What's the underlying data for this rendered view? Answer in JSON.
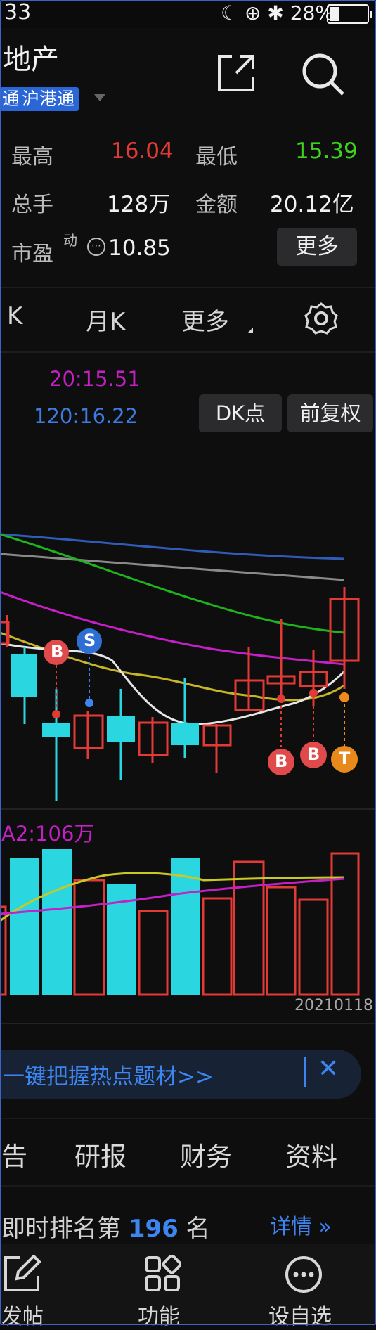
{
  "status_bar": {
    "time": "33",
    "battery": "28%"
  },
  "header": {
    "title": "地产",
    "tag": "沪港通",
    "tag_left": "通"
  },
  "quote": {
    "high_label": "最高",
    "high": "16.04",
    "low_label": "最低",
    "low": "15.39",
    "volume_label": "总手",
    "volume": "128万",
    "amount_label": "金额",
    "amount": "20.12亿",
    "pe_label": "市盈",
    "pe_sup": "动",
    "pe": "10.85",
    "more_button": "更多"
  },
  "period_tabs": {
    "tab1": "K",
    "tab2": "月K",
    "tab3": "更多"
  },
  "ma_labels": {
    "ma20": "20:15.51",
    "ma120": "120:16.22"
  },
  "chart_buttons": {
    "dk": "DK点",
    "fq": "前复权"
  },
  "signals": {
    "b": "B",
    "s": "S",
    "t": "T"
  },
  "volume_label": "A2:106万",
  "date_label": "20210118",
  "banner": {
    "text": "一键把握热点题材>>",
    "close": "✕"
  },
  "sub_tabs": {
    "t1": "告",
    "t2": "研报",
    "t3": "财务",
    "t4": "资料"
  },
  "rank": {
    "prefix": "即时排名第",
    "number": "196",
    "suffix": "名",
    "detail": "详情 »"
  },
  "bottom_bar": {
    "post": "发帖",
    "func": "功能",
    "watch": "设自选"
  },
  "colors": {
    "up": "#e23b36",
    "down": "#2ad7e0",
    "accent": "#3d86f2",
    "ma_purple": "#c51fc6"
  }
}
